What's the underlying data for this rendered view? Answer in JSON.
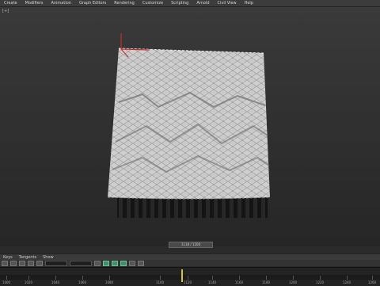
{
  "menu": [
    "Create",
    "Modifiers",
    "Animation",
    "Graph Editors",
    "Rendering",
    "Customize",
    "Scripting",
    "Arnold",
    "Civil View",
    "Help"
  ],
  "viewport": {
    "corner_label": "[+]"
  },
  "timeline": {
    "scrub_label": "1118 / 1200",
    "graph_tabs": [
      "Keys",
      "Tangents",
      "Show"
    ],
    "ticks": [
      "1000",
      "1020",
      "1040",
      "1060",
      "1080",
      "1100",
      "1120",
      "1140",
      "1160",
      "1180",
      "1200",
      "1220",
      "1240",
      "1260"
    ],
    "current_frame": 1118,
    "accent_color": "#d8c038"
  }
}
